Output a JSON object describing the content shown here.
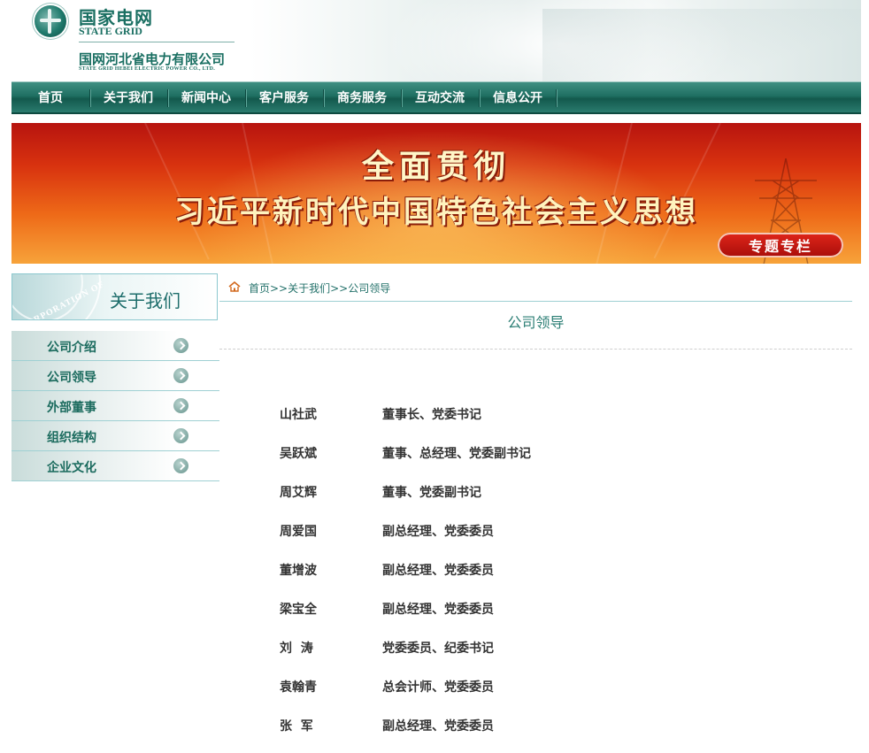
{
  "header": {
    "brand_cn": "国家电网",
    "brand_en": "STATE GRID",
    "company_cn": "国网河北省电力有限公司",
    "company_en": "STATE GRID HEBEI ELECTRIC POWER CO., LTD."
  },
  "nav": {
    "items": [
      "首页",
      "关于我们",
      "新闻中心",
      "客户服务",
      "商务服务",
      "互动交流",
      "信息公开"
    ]
  },
  "banner": {
    "line1": "全面贯彻",
    "line2": "习近平新时代中国特色社会主义思想",
    "tag": "专题专栏"
  },
  "sidebar": {
    "title": "关于我们",
    "seal_text": "CORPORATION OF",
    "items": [
      "公司介绍",
      "公司领导",
      "外部董事",
      "组织结构",
      "企业文化"
    ]
  },
  "main": {
    "breadcrumb": "首页>>关于我们>>公司领导",
    "page_title": "公司领导",
    "leaders": [
      {
        "name": "山社武",
        "title": "董事长、党委书记"
      },
      {
        "name": "吴跃斌",
        "title": "董事、总经理、党委副书记"
      },
      {
        "name": "周艾辉",
        "title": "董事、党委副书记"
      },
      {
        "name": "周爱国",
        "title": "副总经理、党委委员"
      },
      {
        "name": "董增波",
        "title": "副总经理、党委委员"
      },
      {
        "name": "梁宝全",
        "title": "副总经理、党委委员"
      },
      {
        "name": "刘  涛",
        "title": "党委委员、纪委书记"
      },
      {
        "name": "袁翰青",
        "title": "总会计师、党委委员"
      },
      {
        "name": "张  军",
        "title": "副总经理、党委委员"
      }
    ]
  },
  "colors": {
    "brand_green": "#1a6f62",
    "nav_green": "#1f6f62",
    "banner_red": "#d8320f"
  }
}
